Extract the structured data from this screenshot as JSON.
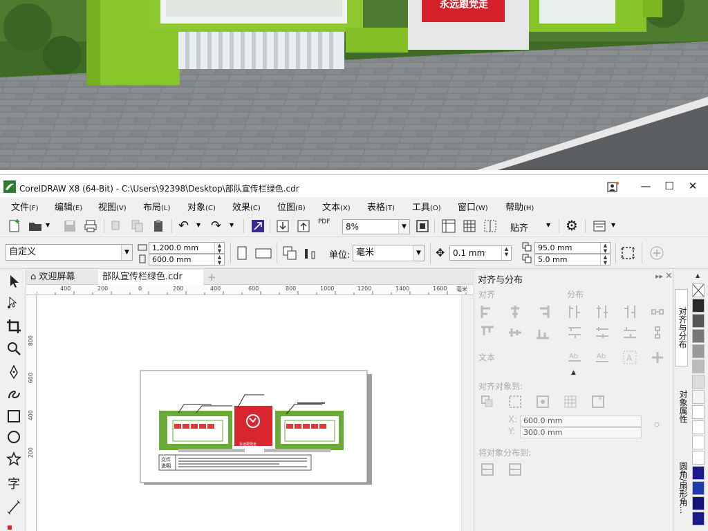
{
  "window": {
    "title": "CorelDRAW X8 (64-Bit) - C:\\Users\\92398\\Desktop\\部队宣传栏绿色.cdr"
  },
  "menu": [
    {
      "label": "文件",
      "key": "(F)"
    },
    {
      "label": "编辑",
      "key": "(E)"
    },
    {
      "label": "视图",
      "key": "(V)"
    },
    {
      "label": "布局",
      "key": "(L)"
    },
    {
      "label": "对象",
      "key": "(C)"
    },
    {
      "label": "效果",
      "key": "(C)"
    },
    {
      "label": "位图",
      "key": "(B)"
    },
    {
      "label": "文本",
      "key": "(X)"
    },
    {
      "label": "表格",
      "key": "(T)"
    },
    {
      "label": "工具",
      "key": "(O)"
    },
    {
      "label": "窗口",
      "key": "(W)"
    },
    {
      "label": "帮助",
      "key": "(H)"
    }
  ],
  "toolbar": {
    "zoom_value": "8%",
    "snap_label": "贴齐",
    "pdf_label": "PDF"
  },
  "property_bar": {
    "page_size_preset": "自定义",
    "width": "1,200.0 mm",
    "height": "600.0 mm",
    "units_label": "单位:",
    "units_value": "毫米",
    "nudge": "0.1 mm",
    "dup_x": "95.0 mm",
    "dup_y": "5.0 mm"
  },
  "tabs": {
    "welcome": "欢迎屏幕",
    "document": "部队宣传栏绿色.cdr"
  },
  "ruler": {
    "h_ticks": [
      "400",
      "200",
      "0",
      "200",
      "400",
      "600",
      "800",
      "1000",
      "1200",
      "1400",
      "1600"
    ],
    "h_unit": "毫米",
    "v_ticks": [
      "800",
      "600",
      "400",
      "200"
    ]
  },
  "artwork": {
    "badge_text": "永远跟党走",
    "note_label_line1": "文件",
    "note_label_line2": "说明"
  },
  "docker": {
    "title": "对齐与分布",
    "section_align": "对齐",
    "section_distribute": "分布",
    "section_text": "文本",
    "align_to_label": "对齐对象到:",
    "x_value": "600.0 mm",
    "y_value": "300.0 mm",
    "x_label": "X:",
    "y_label": "Y:",
    "distribute_to_label": "将对象分布到:"
  },
  "docker_tabs": [
    "对齐与分布",
    "对象属性",
    "圆角/扇形角..."
  ],
  "palette": [
    "#ffffff",
    "#2b2b2b",
    "#555555",
    "#777777",
    "#999999",
    "#bbbbbb",
    "#dddddd",
    "#f4f4f4",
    "#1b1b8c",
    "#1f3ca8",
    "#12127a"
  ]
}
